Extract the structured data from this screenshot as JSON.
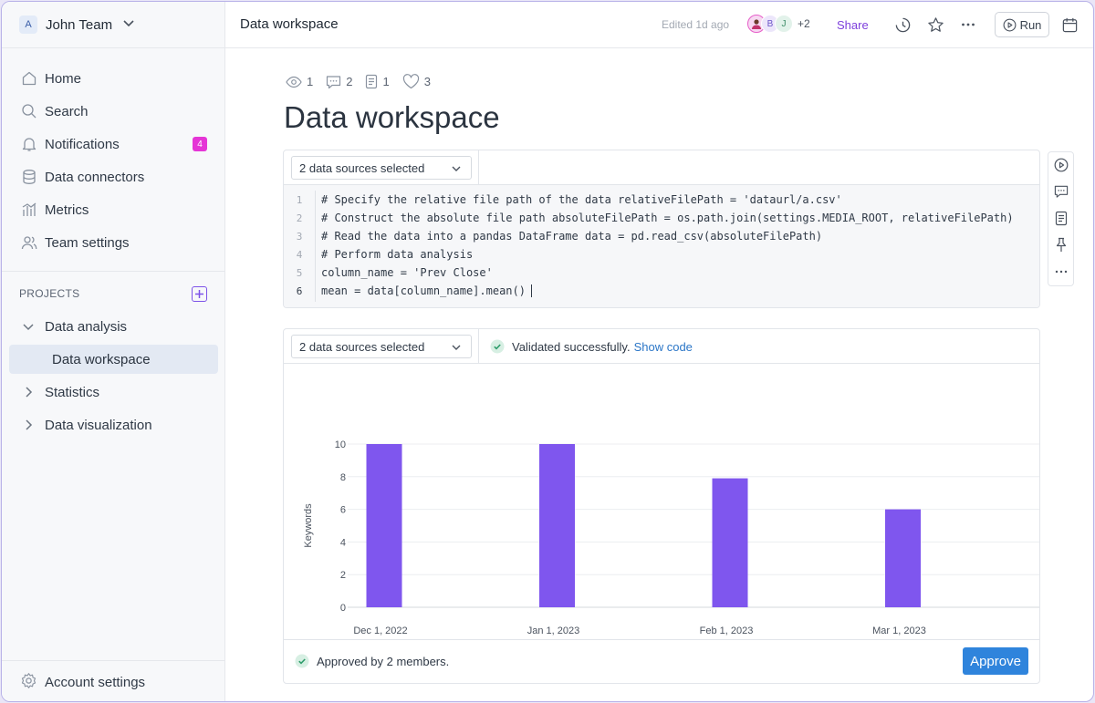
{
  "sidebar": {
    "team": {
      "avatar_letter": "A",
      "name": "John Team"
    },
    "nav": [
      {
        "label": "Home",
        "icon": "home-icon"
      },
      {
        "label": "Search",
        "icon": "search-icon"
      },
      {
        "label": "Notifications",
        "icon": "bell-icon",
        "badge": "4"
      },
      {
        "label": "Data connectors",
        "icon": "database-icon"
      },
      {
        "label": "Metrics",
        "icon": "metrics-icon"
      },
      {
        "label": "Team settings",
        "icon": "team-icon"
      }
    ],
    "projects_title": "PROJECTS",
    "tree": {
      "open_folder": "Data analysis",
      "active_child": "Data workspace",
      "folders": [
        "Statistics",
        "Data visualization"
      ]
    },
    "account_label": "Account settings"
  },
  "topbar": {
    "page_name": "Data workspace",
    "edited": "Edited 1d ago",
    "avatars": [
      "B",
      "J"
    ],
    "avatars_more": "+2",
    "share_label": "Share",
    "run_label": "Run"
  },
  "stats": {
    "views": "1",
    "comments": "2",
    "docs": "1",
    "likes": "3"
  },
  "title": "Data workspace",
  "code_panel": {
    "source_select": "2 data sources selected",
    "lines": [
      {
        "n": "1",
        "text": "# Specify the relative file path of the data relativeFilePath = 'dataurl/a.csv'"
      },
      {
        "n": "2",
        "text": "# Construct the absolute file path absoluteFilePath = os.path.join(settings.MEDIA_ROOT, relativeFilePath)"
      },
      {
        "n": "3",
        "text": "# Read the data into a pandas DataFrame data = pd.read_csv(absoluteFilePath)"
      },
      {
        "n": "4",
        "text": "# Perform data analysis"
      },
      {
        "n": "5",
        "text": "column_name = 'Prev Close'"
      },
      {
        "n": "6",
        "text": "mean = data[column_name].mean()"
      }
    ]
  },
  "chart_panel": {
    "source_select": "2 data sources selected",
    "validated": "Validated successfully.",
    "show_code": "Show code",
    "approved": "Approved by 2 members.",
    "approve_label": "Approve"
  },
  "colors": {
    "accent": "#7d3fdc",
    "bar": "#7f56ee",
    "badge": "#e535d6",
    "approve": "#2f84dc",
    "success": "#2e9d6b"
  },
  "chart_data": {
    "type": "bar",
    "categories": [
      "Dec 1, 2022",
      "Jan 1, 2023",
      "Feb 1, 2023",
      "Mar 1, 2023"
    ],
    "values": [
      10,
      10,
      7.9,
      6
    ],
    "ylabel": "Keywords",
    "xlabel": "",
    "ylim": [
      0,
      10
    ],
    "yticks": [
      0,
      2,
      4,
      6,
      8,
      10
    ],
    "grid": true
  }
}
